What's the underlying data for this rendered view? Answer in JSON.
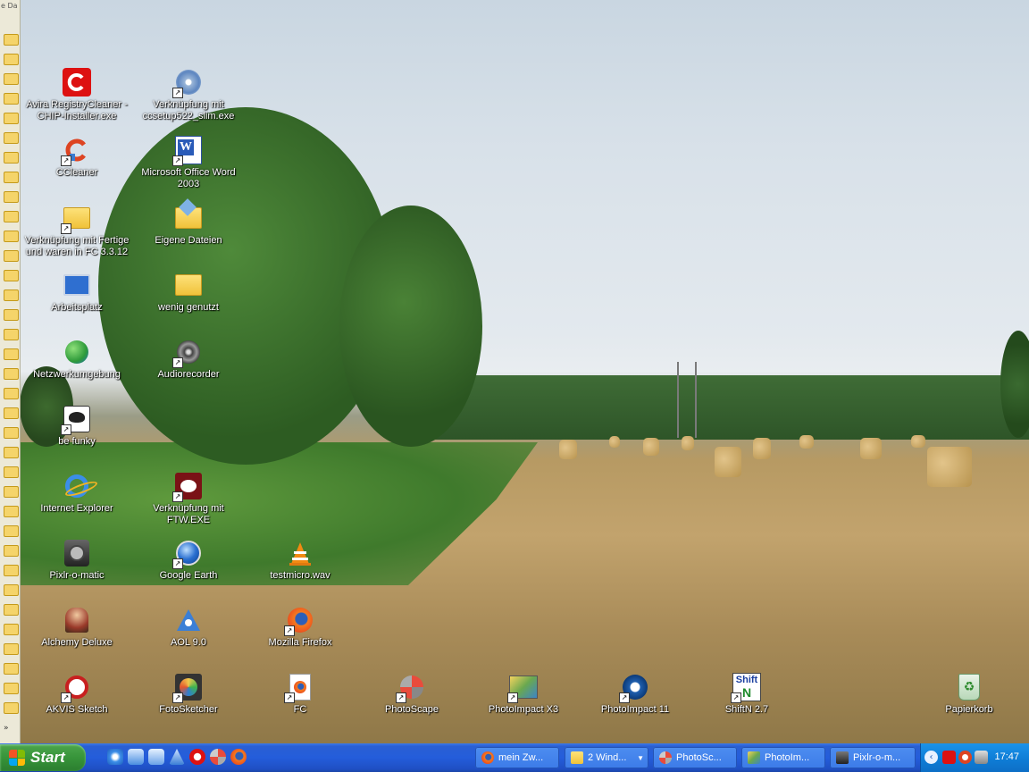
{
  "left_strip": {
    "top_label": "e Da",
    "more_label": "»"
  },
  "desktop_icons": [
    {
      "label": "Avira RegistryCleaner - CHIP-Installer.exe",
      "icon": "chip-installer-icon"
    },
    {
      "label": "Verknüpfung mit ccsetup522_slim.exe",
      "icon": "setup-disc-icon"
    },
    {
      "label": "CCleaner",
      "icon": "ccleaner-icon"
    },
    {
      "label": "Microsoft Office Word 2003",
      "icon": "word-icon"
    },
    {
      "label": "Verknüpfung mit Fertige und waren in FC 3.3.12",
      "icon": "folder-icon"
    },
    {
      "label": "Eigene Dateien",
      "icon": "my-documents-icon"
    },
    {
      "label": "Arbeitsplatz",
      "icon": "my-computer-icon"
    },
    {
      "label": "wenig genutzt",
      "icon": "folder-icon"
    },
    {
      "label": "Netzwerkumgebung",
      "icon": "network-icon"
    },
    {
      "label": "Audiorecorder",
      "icon": "speaker-icon"
    },
    {
      "label": "be funky",
      "icon": "be-funky-icon"
    },
    {
      "label": "Internet Explorer",
      "icon": "internet-explorer-icon"
    },
    {
      "label": "Verknüpfung mit FTW.EXE",
      "icon": "psb-icon"
    },
    {
      "label": "Pixlr-o-matic",
      "icon": "pixlr-icon"
    },
    {
      "label": "Google Earth",
      "icon": "google-earth-icon"
    },
    {
      "label": "testmicro.wav",
      "icon": "vlc-icon"
    },
    {
      "label": "Alchemy Deluxe",
      "icon": "alchemy-icon"
    },
    {
      "label": "AOL 9.0",
      "icon": "aol-icon"
    },
    {
      "label": "Mozilla Firefox",
      "icon": "firefox-icon"
    },
    {
      "label": "AKVIS Sketch",
      "icon": "akvis-icon"
    },
    {
      "label": "FotoSketcher",
      "icon": "fotosketcher-icon"
    },
    {
      "label": "FC",
      "icon": "firefox-doc-icon"
    },
    {
      "label": "PhotoScape",
      "icon": "photoscape-icon"
    },
    {
      "label": "PhotoImpact X3",
      "icon": "photoimpact-x3-icon"
    },
    {
      "label": "PhotoImpact 11",
      "icon": "photoimpact-11-icon"
    },
    {
      "label": "ShiftN 2.7",
      "icon": "shiftn-icon"
    },
    {
      "label": "Papierkorb",
      "icon": "recycle-bin-icon"
    }
  ],
  "shiftn_icon_text": {
    "top": "Shift",
    "bottom": "N"
  },
  "taskbar": {
    "start_label": "Start",
    "quick_launch": [
      "internet-explorer-icon",
      "outlook-icon",
      "outlook-express-icon",
      "aol-icon",
      "chip-icon",
      "photoscape-icon",
      "firefox-icon"
    ],
    "tasks": [
      {
        "label": "mein Zw...",
        "icon": "firefox-icon"
      },
      {
        "label": "2 Wind...",
        "icon": "folder-icon",
        "has_dropdown": true
      },
      {
        "label": "PhotoSc...",
        "icon": "photoscape-icon"
      },
      {
        "label": "PhotoIm...",
        "icon": "photoimpact-icon"
      },
      {
        "label": "Pixlr-o-m...",
        "icon": "pixlr-icon"
      }
    ],
    "tray": {
      "clock": "17:47",
      "icons": [
        "expand-arrow-icon",
        "avira-icon",
        "ccleaner-tray-icon",
        "safely-remove-icon"
      ]
    }
  },
  "colors": {
    "taskbar_blue": "#245ddb",
    "start_green": "#37943a",
    "tray_blue": "#0f7fd8"
  }
}
